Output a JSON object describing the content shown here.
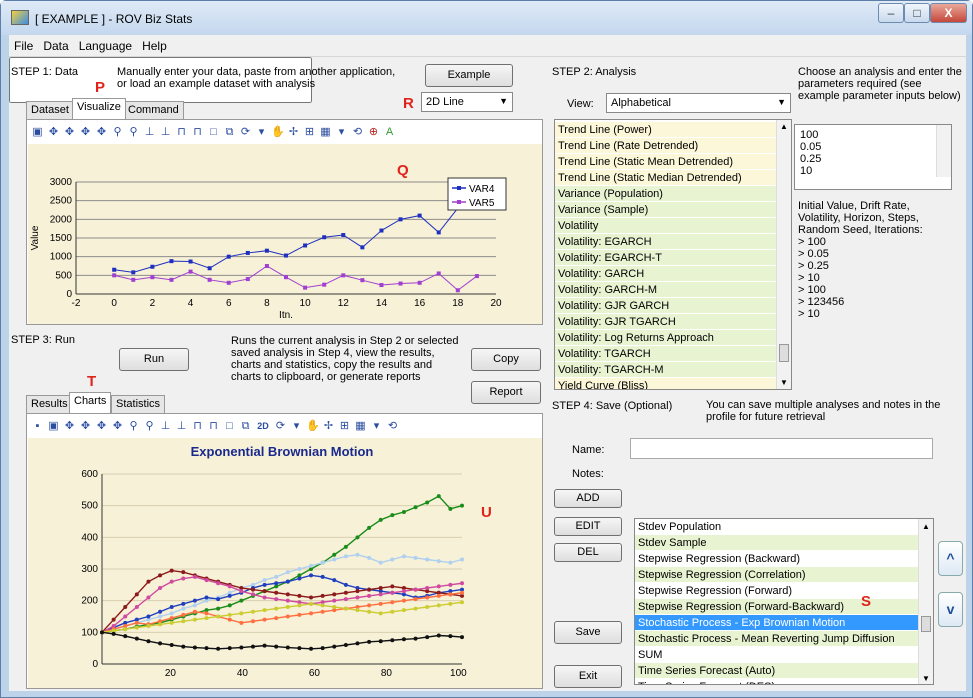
{
  "window": {
    "title": "[ EXAMPLE ] - ROV Biz Stats",
    "controls": [
      "–",
      "□",
      "X"
    ]
  },
  "menu": [
    "File",
    "Data",
    "Language",
    "Help"
  ],
  "step1": {
    "label": "STEP 1: Data",
    "desc_line1": "Manually enter your data, paste from another application,",
    "desc_line2": "or load an example dataset with analysis",
    "example_button": "Example",
    "tabs": [
      "Dataset",
      "Visualize",
      "Command"
    ],
    "chart_type": "2D Line",
    "marker_p": "P",
    "marker_r": "R",
    "marker_q": "Q"
  },
  "step2": {
    "label": "STEP 2: Analysis",
    "view_label": "View:",
    "view_value": "Alphabetical",
    "instructions": "Choose an analysis and enter the parameters required (see example parameter inputs below)",
    "analyses": [
      {
        "label": "Trend Line (Power)",
        "color": "y"
      },
      {
        "label": "Trend Line (Rate Detrended)",
        "color": "y"
      },
      {
        "label": "Trend Line (Static Mean Detrended)",
        "color": "y"
      },
      {
        "label": "Trend Line (Static Median Detrended)",
        "color": "y"
      },
      {
        "label": "Variance (Population)",
        "color": "g"
      },
      {
        "label": "Variance (Sample)",
        "color": "g"
      },
      {
        "label": "Volatility",
        "color": "g"
      },
      {
        "label": "Volatility: EGARCH",
        "color": "g"
      },
      {
        "label": "Volatility: EGARCH-T",
        "color": "g"
      },
      {
        "label": "Volatility: GARCH",
        "color": "g"
      },
      {
        "label": "Volatility: GARCH-M",
        "color": "g"
      },
      {
        "label": "Volatility: GJR GARCH",
        "color": "g"
      },
      {
        "label": "Volatility: GJR TGARCH",
        "color": "g"
      },
      {
        "label": "Volatility: Log Returns Approach",
        "color": "g"
      },
      {
        "label": "Volatility: TGARCH",
        "color": "g"
      },
      {
        "label": "Volatility: TGARCH-M",
        "color": "g"
      },
      {
        "label": "Yield Curve (Bliss)",
        "color": "y"
      }
    ],
    "params": [
      "100",
      "0.05",
      "0.25",
      "10"
    ],
    "param_desc": "Initial Value, Drift Rate, Volatility, Horizon, Steps, Random Seed, Iterations:",
    "param_examples": [
      ">  100",
      ">  0.05",
      ">  0.25",
      ">  10",
      ">  100",
      ">  123456",
      ">  10"
    ]
  },
  "step3": {
    "label": "STEP 3: Run",
    "run_button": "Run",
    "desc": "Runs the current analysis in Step 2 or selected saved analysis in Step 4, view the results, charts and statistics, copy the results and charts to clipboard, or generate reports",
    "copy_button": "Copy",
    "report_button": "Report",
    "tabs": [
      "Results",
      "Charts",
      "Statistics"
    ],
    "marker_t": "T",
    "marker_u": "U"
  },
  "step4": {
    "label": "STEP 4: Save (Optional)",
    "desc": "You can save multiple analyses and notes in the profile for future retrieval",
    "name_label": "Name:",
    "notes_label": "Notes:",
    "add_button": "ADD",
    "edit_button": "EDIT",
    "del_button": "DEL",
    "save_button": "Save",
    "exit_button": "Exit",
    "marker_s": "S",
    "saved": [
      {
        "label": "Stdev Population",
        "color": "w"
      },
      {
        "label": "Stdev Sample",
        "color": "g"
      },
      {
        "label": "Stepwise Regression (Backward)",
        "color": "w"
      },
      {
        "label": "Stepwise Regression (Correlation)",
        "color": "g"
      },
      {
        "label": "Stepwise Regression (Forward)",
        "color": "w"
      },
      {
        "label": "Stepwise Regression (Forward-Backward)",
        "color": "g"
      },
      {
        "label": "Stochastic Process - Exp Brownian Motion",
        "color": "sel"
      },
      {
        "label": "Stochastic Process - Mean Reverting Jump Diffusion",
        "color": "g"
      },
      {
        "label": "SUM",
        "color": "w"
      },
      {
        "label": "Time Series Forecast (Auto)",
        "color": "g"
      },
      {
        "label": "Time Series Forecast (DES)",
        "color": "w"
      }
    ],
    "up_arrow": "^",
    "down_arrow": "v"
  },
  "chart_data": [
    {
      "type": "line",
      "title": "",
      "xlabel": "Itn.",
      "ylabel": "Value",
      "xlim": [
        -2,
        20
      ],
      "ylim": [
        0,
        3000
      ],
      "xticks": [
        -2,
        0,
        2,
        4,
        6,
        8,
        10,
        12,
        14,
        16,
        18,
        20
      ],
      "yticks": [
        0,
        500,
        1000,
        1500,
        2000,
        2500,
        3000
      ],
      "legend": "top-right",
      "x": [
        0,
        1,
        2,
        3,
        4,
        5,
        6,
        7,
        8,
        9,
        10,
        11,
        12,
        13,
        14,
        15,
        16,
        17,
        18,
        19
      ],
      "series": [
        {
          "name": "VAR4",
          "color": "#1f2fbf",
          "values": [
            650,
            580,
            730,
            880,
            870,
            690,
            1000,
            1100,
            1160,
            1030,
            1300,
            1520,
            1580,
            1250,
            1700,
            2000,
            2100,
            1650,
            2300,
            2620
          ]
        },
        {
          "name": "VAR5",
          "color": "#a13fd1",
          "values": [
            500,
            380,
            450,
            380,
            600,
            380,
            300,
            400,
            750,
            450,
            170,
            250,
            500,
            370,
            240,
            280,
            300,
            550,
            100,
            480
          ]
        }
      ]
    },
    {
      "type": "line",
      "title": "Exponential Brownian Motion",
      "xlabel": "",
      "ylabel": "",
      "xlim": [
        1,
        101
      ],
      "ylim": [
        0,
        600
      ],
      "xticks": [
        20,
        40,
        60,
        80,
        100
      ],
      "yticks": [
        0,
        100,
        200,
        300,
        400,
        500,
        600
      ],
      "series": [
        {
          "color": "#1a8c1a",
          "values": [
            100,
            105,
            110,
            118,
            125,
            130,
            140,
            150,
            160,
            170,
            175,
            185,
            200,
            215,
            230,
            245,
            260,
            280,
            300,
            320,
            345,
            370,
            400,
            430,
            455,
            470,
            480,
            495,
            510,
            530,
            490,
            500
          ]
        },
        {
          "color": "#b0d0f0",
          "values": [
            100,
            110,
            120,
            130,
            140,
            150,
            160,
            175,
            185,
            200,
            210,
            225,
            240,
            250,
            265,
            275,
            290,
            300,
            310,
            320,
            330,
            340,
            345,
            335,
            320,
            330,
            340,
            335,
            330,
            325,
            320,
            330
          ]
        },
        {
          "color": "#1f3fbf",
          "values": [
            100,
            115,
            130,
            140,
            150,
            165,
            180,
            190,
            200,
            210,
            205,
            215,
            225,
            240,
            250,
            255,
            260,
            270,
            280,
            275,
            265,
            250,
            240,
            235,
            230,
            225,
            220,
            210,
            215,
            225,
            230,
            235
          ]
        },
        {
          "color": "#8c1a1a",
          "values": [
            100,
            140,
            180,
            220,
            260,
            280,
            295,
            290,
            280,
            270,
            260,
            250,
            240,
            235,
            230,
            225,
            220,
            215,
            210,
            215,
            220,
            225,
            230,
            235,
            240,
            245,
            240,
            235,
            230,
            225,
            220,
            215
          ]
        },
        {
          "color": "#d04aa0",
          "values": [
            100,
            120,
            150,
            180,
            210,
            240,
            260,
            270,
            275,
            265,
            255,
            245,
            230,
            220,
            210,
            205,
            200,
            195,
            190,
            195,
            200,
            205,
            210,
            215,
            220,
            225,
            230,
            235,
            240,
            245,
            250,
            255
          ]
        },
        {
          "color": "#ff7040",
          "values": [
            100,
            110,
            120,
            130,
            125,
            135,
            145,
            155,
            165,
            160,
            150,
            140,
            130,
            135,
            140,
            145,
            150,
            155,
            160,
            165,
            170,
            175,
            180,
            185,
            190,
            195,
            200,
            205,
            210,
            215,
            220,
            225
          ]
        },
        {
          "color": "#cccc33",
          "values": [
            100,
            105,
            110,
            115,
            120,
            125,
            130,
            135,
            140,
            145,
            150,
            155,
            160,
            165,
            170,
            175,
            180,
            185,
            190,
            185,
            180,
            175,
            170,
            165,
            160,
            165,
            170,
            175,
            180,
            185,
            190,
            195
          ]
        },
        {
          "color": "#111111",
          "values": [
            100,
            95,
            88,
            80,
            72,
            65,
            60,
            55,
            52,
            50,
            48,
            50,
            52,
            55,
            58,
            55,
            52,
            50,
            48,
            50,
            55,
            60,
            65,
            70,
            72,
            75,
            78,
            80,
            85,
            90,
            88,
            85
          ]
        }
      ]
    }
  ]
}
